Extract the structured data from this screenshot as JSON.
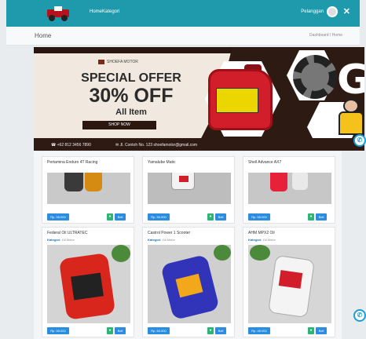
{
  "topbar": {
    "nav": [
      "Home",
      "Kategori"
    ],
    "profile_name": "Pelanggan"
  },
  "breadcrumb": {
    "title": "Home",
    "path": "Dashboard / Home"
  },
  "banner": {
    "brand": "SHOEFA MOTOR",
    "headline": "SPECIAL OFFER",
    "discount": "30% OFF",
    "subline": "All Item",
    "button_label": "SHOP NOW",
    "phone": "+62 812 3456 7890",
    "email": "Jl. Contoh No. 123 shoefamotor@gmail.com"
  },
  "products": [
    {
      "title": "Pertamina Enduro 4T Racing",
      "price": "Rp. 55.000",
      "cart": "Beli"
    },
    {
      "title": "Yamalube Matic",
      "price": "Rp. 50.000",
      "cart": "Beli"
    },
    {
      "title": "Shell Advance AX7",
      "price": "Rp. 65.000",
      "cart": "Beli"
    },
    {
      "title": "Federal Oil ULTRATEC",
      "price": "Rp. 55.000",
      "cart": "Beli",
      "category_label": "Kategori:",
      "category": "Oli Motor"
    },
    {
      "title": "Castrol Power 1 Scooter",
      "price": "Rp. 60.000",
      "cart": "Beli",
      "category_label": "Kategori:",
      "category": "Oli Motor"
    },
    {
      "title": "AHM MPX2 Oil",
      "price": "Rp. 45.000",
      "cart": "Beli",
      "category_label": "Kategori:",
      "category": "Oli Motor"
    }
  ],
  "colors": {
    "topbar": "#1f9aad",
    "banner_dark": "#2d1a12",
    "price_blue": "#2b8de0",
    "action_green": "#2bb673"
  }
}
